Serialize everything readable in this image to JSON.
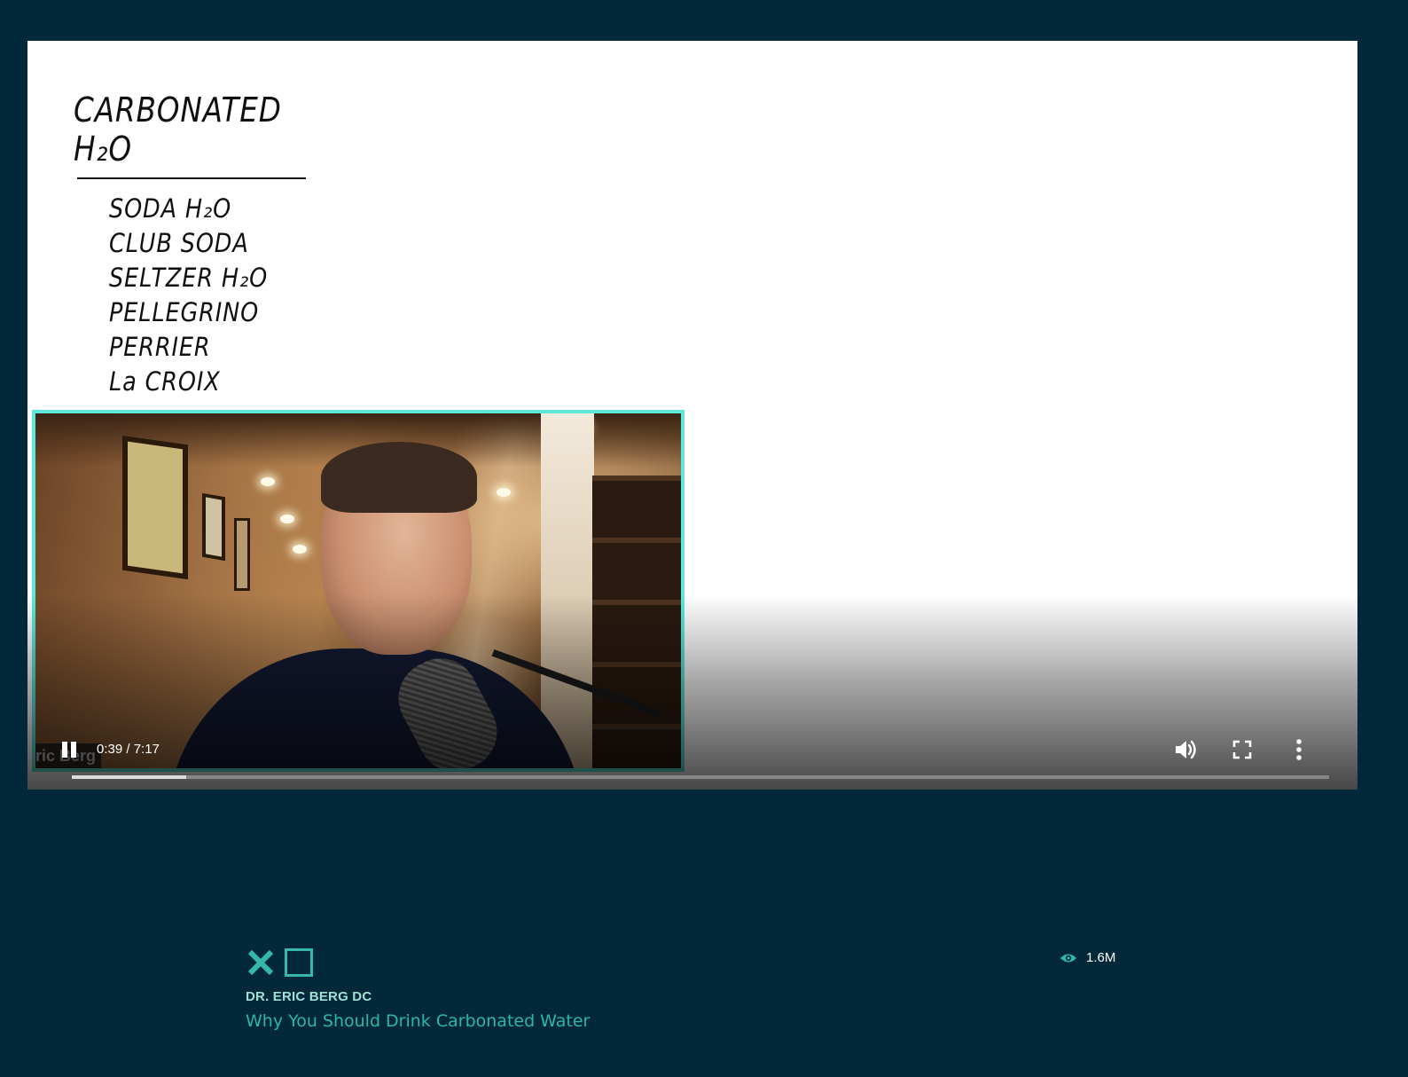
{
  "player": {
    "whiteboard": {
      "title": "CARBONATED H₂O",
      "items": [
        "SODA H₂O",
        "CLUB SODA",
        "SELTZER H₂O",
        "PELLEGRINO",
        "PERRIER",
        "La CROIX"
      ]
    },
    "webcam_name_tag": "ric Berg",
    "time_display": "0:39 / 7:17",
    "progress_fraction": 0.0907,
    "icons": {
      "play_pause": "pause-icon",
      "volume": "volume-icon",
      "fullscreen": "fullscreen-icon",
      "more": "more-vert-icon"
    }
  },
  "video_info": {
    "channel": "DR. ERIC BERG DC",
    "title": "Why You Should Drink Carbonated Water",
    "views": "1.6M",
    "icons": {
      "close": "close-icon",
      "square": "square-icon",
      "views": "eye-icon"
    }
  },
  "colors": {
    "page_background": "#03283a",
    "accent": "#35b7a9",
    "pip_border": "#5ee7da"
  }
}
